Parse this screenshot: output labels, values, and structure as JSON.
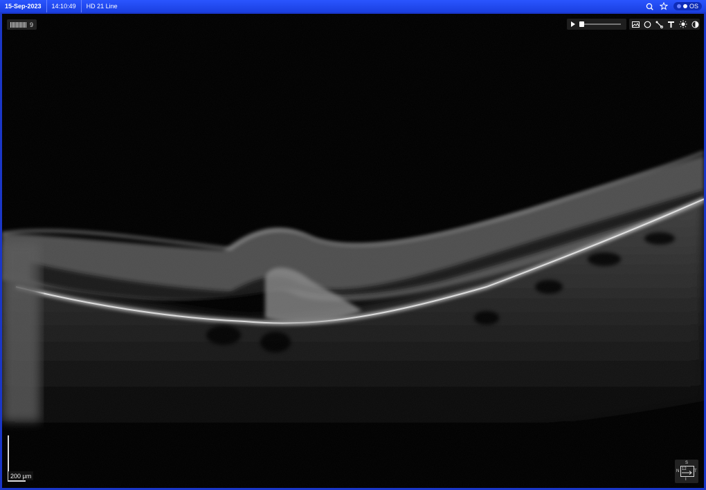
{
  "topbar": {
    "date": "15-Sep-2023",
    "time": "14:10:49",
    "scan_type": "HD 21 Line",
    "eye_label": "OS"
  },
  "viewer": {
    "frame_count": "9",
    "scale_label": "200 µm",
    "orientation": {
      "top": "S",
      "bottom": "I",
      "left": "N",
      "right": "T",
      "number": "12"
    }
  },
  "icons": [
    "search-icon",
    "star-icon",
    "play-icon",
    "image-icon",
    "ellipse-icon",
    "measure-icon",
    "text-icon",
    "brightness-icon",
    "contrast-icon"
  ],
  "colors": {
    "titlebar": "#1a3fe0",
    "background": "#000000",
    "accent": "#2a55ff"
  }
}
